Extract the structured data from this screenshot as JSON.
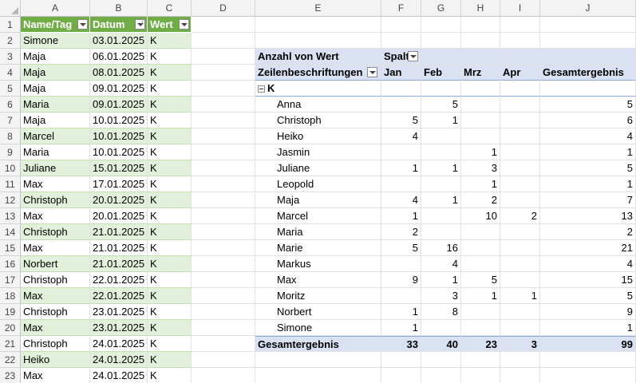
{
  "columns": [
    "A",
    "B",
    "C",
    "D",
    "E",
    "F",
    "G",
    "H",
    "I",
    "J"
  ],
  "row_numbers": [
    1,
    2,
    3,
    4,
    5,
    6,
    7,
    8,
    9,
    10,
    11,
    12,
    13,
    14,
    15,
    16,
    17,
    18,
    19,
    20,
    21,
    22,
    23
  ],
  "table": {
    "headers": [
      "Name/Tag",
      "Datum",
      "Wert"
    ],
    "rows": [
      [
        "Simone",
        "03.01.2025",
        "K"
      ],
      [
        "Maja",
        "06.01.2025",
        "K"
      ],
      [
        "Maja",
        "08.01.2025",
        "K"
      ],
      [
        "Maja",
        "09.01.2025",
        "K"
      ],
      [
        "Maria",
        "09.01.2025",
        "K"
      ],
      [
        "Maja",
        "10.01.2025",
        "K"
      ],
      [
        "Marcel",
        "10.01.2025",
        "K"
      ],
      [
        "Maria",
        "10.01.2025",
        "K"
      ],
      [
        "Juliane",
        "15.01.2025",
        "K"
      ],
      [
        "Max",
        "17.01.2025",
        "K"
      ],
      [
        "Christoph",
        "20.01.2025",
        "K"
      ],
      [
        "Max",
        "20.01.2025",
        "K"
      ],
      [
        "Christoph",
        "21.01.2025",
        "K"
      ],
      [
        "Max",
        "21.01.2025",
        "K"
      ],
      [
        "Norbert",
        "21.01.2025",
        "K"
      ],
      [
        "Christoph",
        "22.01.2025",
        "K"
      ],
      [
        "Max",
        "22.01.2025",
        "K"
      ],
      [
        "Christoph",
        "23.01.2025",
        "K"
      ],
      [
        "Max",
        "23.01.2025",
        "K"
      ],
      [
        "Christoph",
        "24.01.2025",
        "K"
      ],
      [
        "Heiko",
        "24.01.2025",
        "K"
      ],
      [
        "Max",
        "24.01.2025",
        "K"
      ]
    ]
  },
  "pivot": {
    "value_field": "Anzahl von Wert",
    "column_field": "Spalt",
    "row_label": "Zeilenbeschriftungen",
    "months": [
      "Jan",
      "Feb",
      "Mrz",
      "Apr"
    ],
    "grand_total_label": "Gesamtergebnis",
    "group": "K",
    "rows": [
      {
        "name": "Anna",
        "values": [
          "",
          "5",
          "",
          ""
        ],
        "total": "5"
      },
      {
        "name": "Christoph",
        "values": [
          "5",
          "1",
          "",
          ""
        ],
        "total": "6"
      },
      {
        "name": "Heiko",
        "values": [
          "4",
          "",
          "",
          ""
        ],
        "total": "4"
      },
      {
        "name": "Jasmin",
        "values": [
          "",
          "",
          "1",
          ""
        ],
        "total": "1"
      },
      {
        "name": "Juliane",
        "values": [
          "1",
          "1",
          "3",
          ""
        ],
        "total": "5"
      },
      {
        "name": "Leopold",
        "values": [
          "",
          "",
          "1",
          ""
        ],
        "total": "1"
      },
      {
        "name": "Maja",
        "values": [
          "4",
          "1",
          "2",
          ""
        ],
        "total": "7"
      },
      {
        "name": "Marcel",
        "values": [
          "1",
          "",
          "10",
          "2"
        ],
        "total": "13"
      },
      {
        "name": "Maria",
        "values": [
          "2",
          "",
          "",
          ""
        ],
        "total": "2"
      },
      {
        "name": "Marie",
        "values": [
          "5",
          "16",
          "",
          ""
        ],
        "total": "21"
      },
      {
        "name": "Markus",
        "values": [
          "",
          "4",
          "",
          ""
        ],
        "total": "4"
      },
      {
        "name": "Max",
        "values": [
          "9",
          "1",
          "5",
          ""
        ],
        "total": "15"
      },
      {
        "name": "Moritz",
        "values": [
          "",
          "3",
          "1",
          "1"
        ],
        "total": "5"
      },
      {
        "name": "Norbert",
        "values": [
          "1",
          "8",
          "",
          ""
        ],
        "total": "9"
      },
      {
        "name": "Simone",
        "values": [
          "1",
          "",
          "",
          ""
        ],
        "total": "1"
      }
    ],
    "totals": [
      "33",
      "40",
      "23",
      "3"
    ],
    "grand_total": "99"
  },
  "colors": {
    "table_header": "#70ad47",
    "table_band": "#e2efda",
    "pivot_header": "#d9e1f2"
  }
}
